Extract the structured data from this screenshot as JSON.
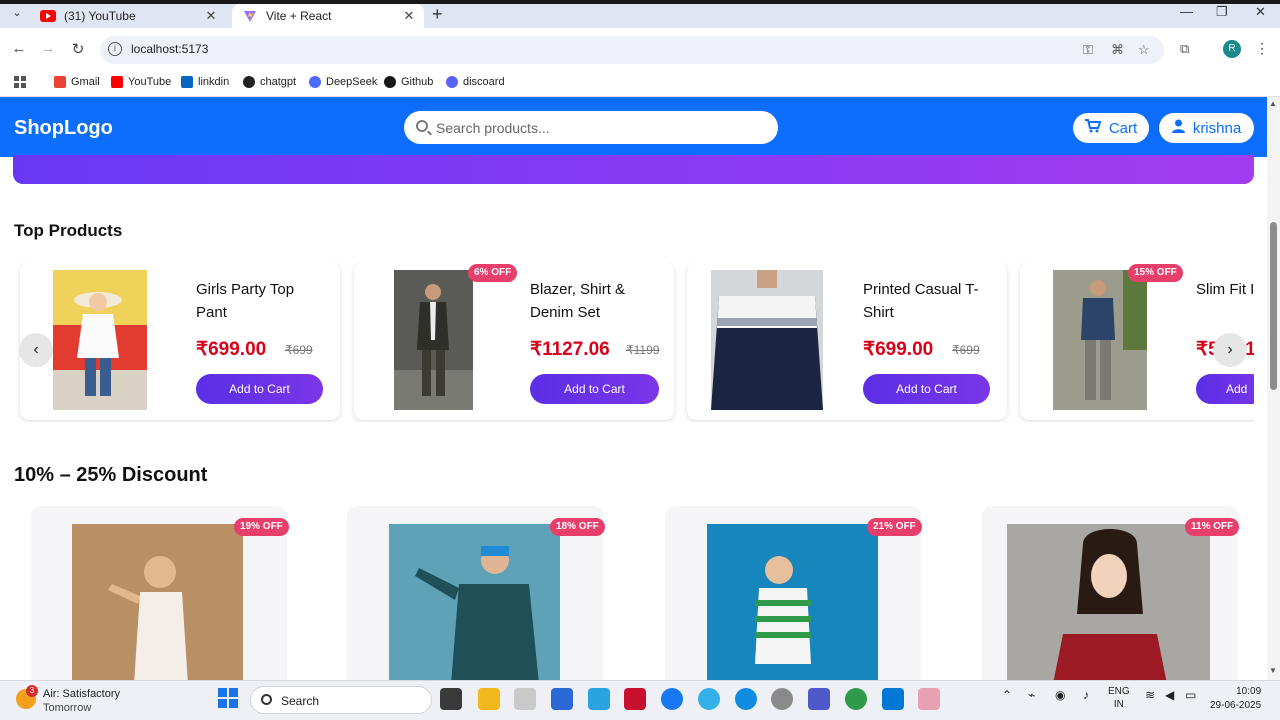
{
  "browser": {
    "tabs": [
      {
        "title": "(31) YouTube",
        "active": false
      },
      {
        "title": "Vite + React",
        "active": true
      }
    ],
    "url": "localhost:5173",
    "profile_initial": "R",
    "bookmarks": [
      {
        "label": "Gmail",
        "color": "#ea4335"
      },
      {
        "label": "YouTube",
        "color": "#ff0000"
      },
      {
        "label": "linkdin",
        "color": "#0a66c2"
      },
      {
        "label": "chatgpt",
        "color": "#222222"
      },
      {
        "label": "DeepSeek",
        "color": "#4d6bfe"
      },
      {
        "label": "Github",
        "color": "#181717"
      },
      {
        "label": "discoard",
        "color": "#5865f2"
      }
    ]
  },
  "header": {
    "logo": "ShopLogo",
    "search_placeholder": "Search products...",
    "cart_label": "Cart",
    "user_label": "krishna",
    "brand_color": "#0d6efd"
  },
  "top_products": {
    "title": "Top Products",
    "items": [
      {
        "name": "Girls Party Top Pant",
        "price": "₹699.00",
        "mrp": "₹699",
        "badge": "",
        "button": "Add to Cart"
      },
      {
        "name": "Blazer, Shirt & Denim Set",
        "price": "₹1127.06",
        "mrp": "₹1199",
        "badge": "6% OFF",
        "button": "Add to Cart"
      },
      {
        "name": "Printed Casual T-Shirt",
        "price": "₹699.00",
        "mrp": "₹699",
        "badge": "",
        "button": "Add to Cart"
      },
      {
        "name": "Slim Fit I",
        "price": "₹509.1",
        "mrp": "",
        "badge": "15% OFF",
        "button": "Add"
      }
    ]
  },
  "discount_section": {
    "title": "10% – 25% Discount",
    "items": [
      {
        "badge": "19% OFF"
      },
      {
        "badge": "18% OFF"
      },
      {
        "badge": "21% OFF"
      },
      {
        "badge": "11% OFF"
      }
    ]
  },
  "taskbar": {
    "weather_badge": "3",
    "weather_line1": "Air: Satisfactory",
    "weather_line2": "Tomorrow",
    "search_label": "Search",
    "lang_line1": "ENG",
    "lang_line2": "IN",
    "time": "10:09",
    "date": "29-06-2025"
  }
}
